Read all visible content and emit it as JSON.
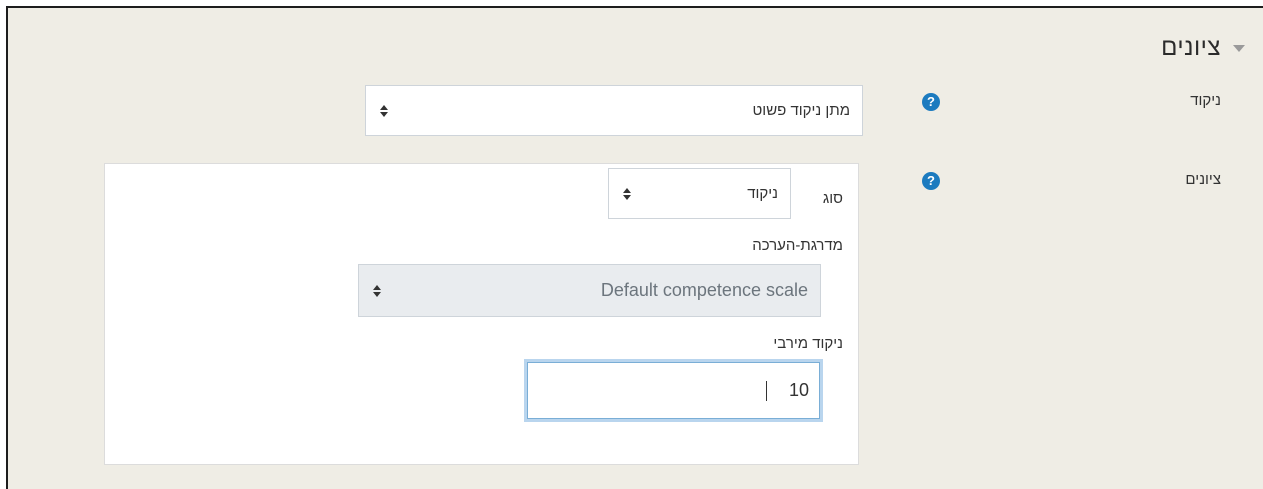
{
  "section": {
    "title": "ציונים",
    "collapse_icon": "chevron-down-icon"
  },
  "grading": {
    "label": "ניקוד",
    "help_icon": "question-circle-icon",
    "help_glyph": "?",
    "select_value": "מתן ניקוד פשוט"
  },
  "grades": {
    "label": "ציונים",
    "help_icon": "question-circle-icon",
    "help_glyph": "?",
    "type_label": "סוג",
    "type_value": "ניקוד",
    "scale_label": "מדרגת-הערכה",
    "scale_value": "Default competence scale",
    "max_label": "ניקוד מירבי",
    "max_value": "10"
  },
  "colors": {
    "background": "#efede5",
    "help": "#1c7bbf",
    "focus": "#7aaed6"
  }
}
